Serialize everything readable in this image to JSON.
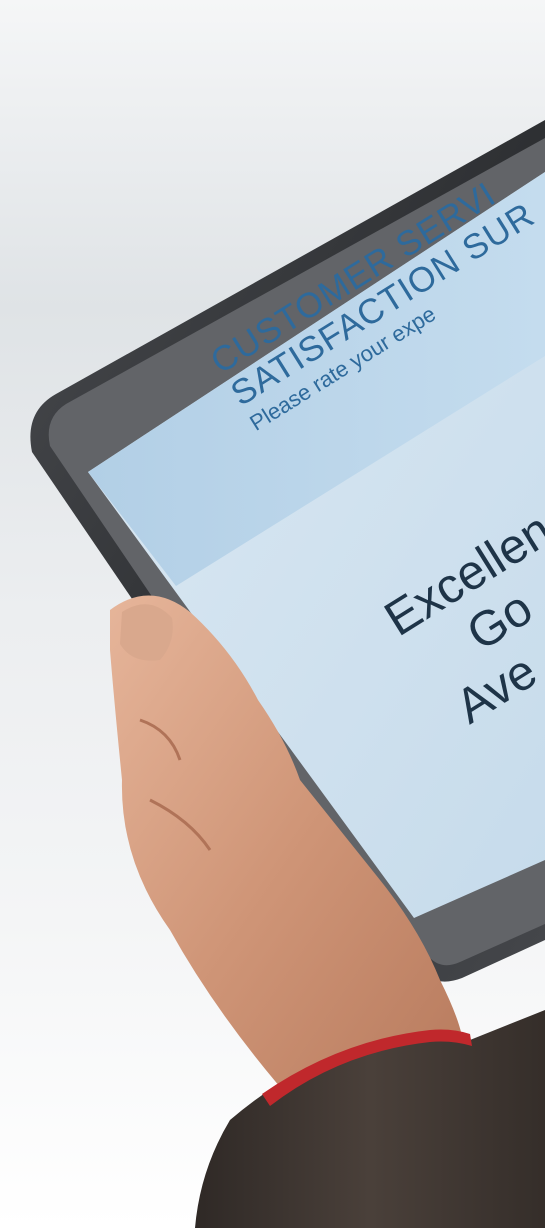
{
  "survey": {
    "title_line1": "CUSTOMER SERVI",
    "title_line2": "SATISFACTION SUR",
    "subtitle": "Please rate your expe",
    "options": [
      "Excellen",
      "Go",
      "Ave"
    ]
  },
  "colors": {
    "banner_text": "#2e6a9c",
    "banner_bg": "#b8d4ea",
    "screen_bg": "#d7e6f1",
    "option_text": "#1e3448",
    "tablet_frame": "#3a3c3f",
    "sleeve": "#3b3430",
    "cuff_accent": "#c0282c"
  }
}
